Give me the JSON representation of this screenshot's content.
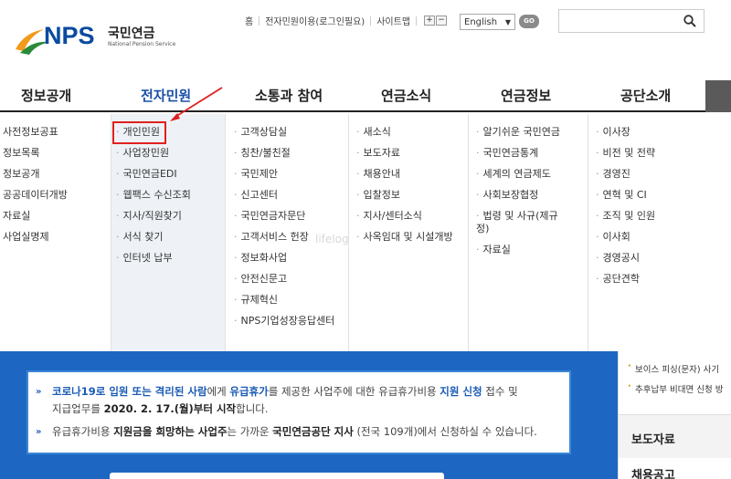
{
  "header": {
    "logo_text": "NPS",
    "logo_kor": "국민연금",
    "logo_eng": "National Pension Service",
    "util_links": [
      "홈",
      "전자민원이용(로그인필요)",
      "사이트맵"
    ],
    "zoom_in": "+",
    "zoom_out": "−",
    "language": "English",
    "go_label": "GO",
    "search_placeholder": ""
  },
  "nav": {
    "items": [
      "정보공개",
      "전자민원",
      "소통과 참여",
      "연금소식",
      "연금정보",
      "공단소개"
    ],
    "active_index": 1
  },
  "menu": {
    "col1": [
      "사전정보공표",
      "정보목록",
      "정보공개",
      "공공데이터개방",
      "자료실",
      "사업실명제"
    ],
    "col2": [
      "개인민원",
      "사업장민원",
      "국민연금EDI",
      "웹팩스 수신조회",
      "지사/직원찾기",
      "서식 찾기",
      "인터넷 납부"
    ],
    "col3": [
      "고객상담실",
      "칭찬/불친절",
      "국민제안",
      "신고센터",
      "국민연금자문단",
      "고객서비스 헌장",
      "정보화사업",
      "안전신문고",
      "규제혁신",
      "NPS기업성장응답센터"
    ],
    "col4": [
      "새소식",
      "보도자료",
      "채용안내",
      "입찰정보",
      "지사/센터소식",
      "사옥임대 및 시설개방"
    ],
    "col5": [
      "알기쉬운 국민연금",
      "국민연금통계",
      "세계의 연금제도",
      "사회보장협정",
      "법령 및 사규(제규정)",
      "자료실"
    ],
    "col6": [
      "이사장",
      "비전 및 전략",
      "경영진",
      "연혁 및 CI",
      "조직 및 인원",
      "이사회",
      "경영공시",
      "공단견학"
    ],
    "highlight": "개인민원"
  },
  "watermark": "lifelog",
  "notice": {
    "line1": {
      "p1": "코로나19로 입원 또는 격리된 사람",
      "p2": "에게 ",
      "p3": "유급휴가",
      "p4": "를 제공한 사업주에 대한 유급휴가비용 ",
      "p5": "지원 신청",
      "p6": " 접수 및"
    },
    "line2": {
      "p1": "지급업무를 ",
      "p2": "2020. 2. 17.(월)부터 시작",
      "p3": "합니다."
    },
    "line3": {
      "p1": "유급휴가비용 ",
      "p2": "지원금을 희망하는 사업주",
      "p3": "는 가까운 ",
      "p4": "국민연금공단 지사",
      "p5": " (전국 109개)에서 신청하실 수 있습니다."
    }
  },
  "side": {
    "items": [
      "보이스 피싱(문자) 사기",
      "추후납부 비대면 신청 방"
    ],
    "press_title": "보도자료",
    "recruit_title": "채용공고"
  },
  "colors": {
    "brand_blue": "#0a4aa0",
    "nav_active": "#1a4fa8",
    "banner_blue": "#1d67c2",
    "highlight_red": "#e02020"
  }
}
